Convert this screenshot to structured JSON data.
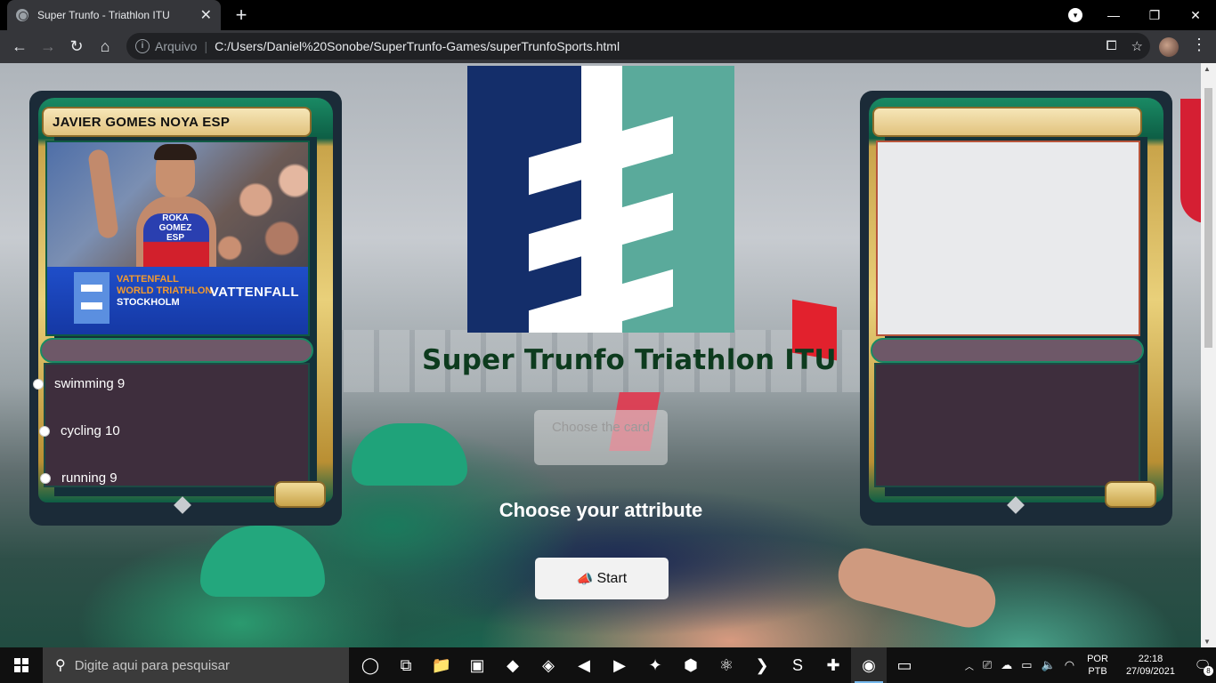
{
  "browser": {
    "tab_title": "Super Trunfo - Triathlon ITU",
    "tab_close": "✕",
    "new_tab": "+",
    "omnibox_prefix": "Arquivo",
    "omnibox_separator": "|",
    "url": "C:/Users/Daniel%20Sonobe/SuperTrunfo-Games/superTrunfoSports.html",
    "window_controls": {
      "minimize": "—",
      "restore": "❐",
      "close": "✕"
    }
  },
  "page": {
    "title": "Super Trunfo Triathlon ITU",
    "choose_card_label": "Choose the card",
    "choose_attribute_label": "Choose your attribute",
    "start_label": "Start",
    "start_icon": "📣"
  },
  "player_card": {
    "name": "JAVIER GOMES NOYA ESP",
    "photo_suit_text": "ROKA GOMEZ ESP",
    "banner_line1": "VATTENFALL",
    "banner_line2": "WORLD TRIATHLON",
    "banner_line3": "STOCKHOLM",
    "banner_brand": "VATTENFALL",
    "attributes": [
      {
        "label": "swimming 9"
      },
      {
        "label": "cycling 10"
      },
      {
        "label": "running 9"
      }
    ]
  },
  "opponent_card": {
    "name": ""
  },
  "taskbar": {
    "search_placeholder": "Digite aqui para pesquisar",
    "lang_line1": "POR",
    "lang_line2": "PTB",
    "time": "22:18",
    "date": "27/09/2021",
    "notification_count": "8",
    "apps": [
      {
        "icon": "task-view-icon",
        "glyph": "◯"
      },
      {
        "icon": "timeline-icon",
        "glyph": "⧉"
      },
      {
        "icon": "file-explorer-icon",
        "glyph": "📁"
      },
      {
        "icon": "pycharm-icon",
        "glyph": "▣"
      },
      {
        "icon": "python-icon",
        "glyph": "◆"
      },
      {
        "icon": "python-idle-icon",
        "glyph": "◈"
      },
      {
        "icon": "vscode-icon",
        "glyph": "◀"
      },
      {
        "icon": "visual-studio-icon",
        "glyph": "▶"
      },
      {
        "icon": "sourcetree-icon",
        "glyph": "✦"
      },
      {
        "icon": "nodejs-icon",
        "glyph": "⬢"
      },
      {
        "icon": "atom-icon",
        "glyph": "⚛"
      },
      {
        "icon": "powershell-icon",
        "glyph": "❯"
      },
      {
        "icon": "sublime-icon",
        "glyph": "S"
      },
      {
        "icon": "slack-icon",
        "glyph": "✚"
      },
      {
        "icon": "chrome-icon",
        "glyph": "◉"
      },
      {
        "icon": "terminal-icon",
        "glyph": "▭"
      }
    ]
  },
  "colors": {
    "title_green": "#0d3b1e",
    "logo_navy": "#142e6a",
    "logo_teal": "#5aaa9b",
    "card_border": "#1b2b38",
    "card_textbox": "#3e2e3d"
  }
}
